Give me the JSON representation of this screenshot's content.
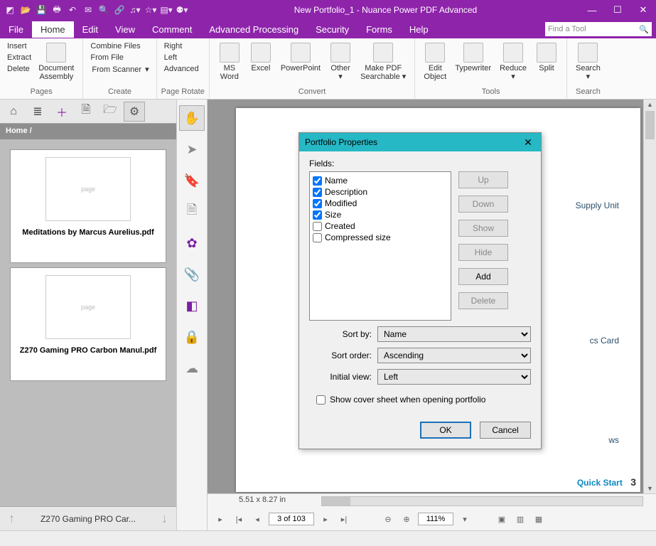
{
  "window": {
    "title": "New Portfolio_1 - Nuance Power PDF Advanced",
    "find_placeholder": "Find a Tool"
  },
  "menu": {
    "file": "File",
    "home": "Home",
    "edit": "Edit",
    "view": "View",
    "comment": "Comment",
    "adv": "Advanced Processing",
    "security": "Security",
    "forms": "Forms",
    "help": "Help"
  },
  "ribbon": {
    "pages": {
      "label": "Pages",
      "insert": "Insert",
      "extract": "Extract",
      "delete": "Delete",
      "docasm": "Document\nAssembly"
    },
    "create": {
      "label": "Create",
      "combine": "Combine Files",
      "fromfile": "From File",
      "fromscan": "From Scanner"
    },
    "rotate": {
      "label": "Page Rotate",
      "right": "Right",
      "left": "Left",
      "advanced": "Advanced"
    },
    "convert": {
      "label": "Convert",
      "word": "MS\nWord",
      "excel": "Excel",
      "ppt": "PowerPoint",
      "other": "Other",
      "search": "Make PDF\nSearchable"
    },
    "tools": {
      "label": "Tools",
      "editobj": "Edit\nObject",
      "type": "Typewriter",
      "reduce": "Reduce",
      "split": "Split"
    },
    "search": {
      "label": "Search",
      "search": "Search"
    }
  },
  "sidepanel": {
    "crumb": "Home /",
    "items": [
      {
        "caption": "Meditations by Marcus Aurelius.pdf"
      },
      {
        "caption": "Z270 Gaming PRO Carbon Manul.pdf"
      }
    ],
    "bottom_caption": "Z270 Gaming PRO Car..."
  },
  "doc": {
    "dims": "5.51 x 8.27 in",
    "page_of": "3 of 103",
    "zoom": "111%",
    "quickstart": "Quick Start",
    "quickstart_n": "3",
    "label_supply": "Supply Unit",
    "label_card": "cs Card",
    "label_ws": "ws"
  },
  "dialog": {
    "title": "Portfolio Properties",
    "fields_label": "Fields:",
    "fields": [
      {
        "label": "Name",
        "checked": true
      },
      {
        "label": "Description",
        "checked": true
      },
      {
        "label": "Modified",
        "checked": true
      },
      {
        "label": "Size",
        "checked": true
      },
      {
        "label": "Created",
        "checked": false
      },
      {
        "label": "Compressed size",
        "checked": false
      }
    ],
    "buttons": {
      "up": "Up",
      "down": "Down",
      "show": "Show",
      "hide": "Hide",
      "add": "Add",
      "delete": "Delete"
    },
    "sortby_label": "Sort by:",
    "sortby": "Name",
    "sortorder_label": "Sort order:",
    "sortorder": "Ascending",
    "initialview_label": "Initial view:",
    "initialview": "Left",
    "cover_label": "Show cover sheet when opening portfolio",
    "ok": "OK",
    "cancel": "Cancel"
  }
}
